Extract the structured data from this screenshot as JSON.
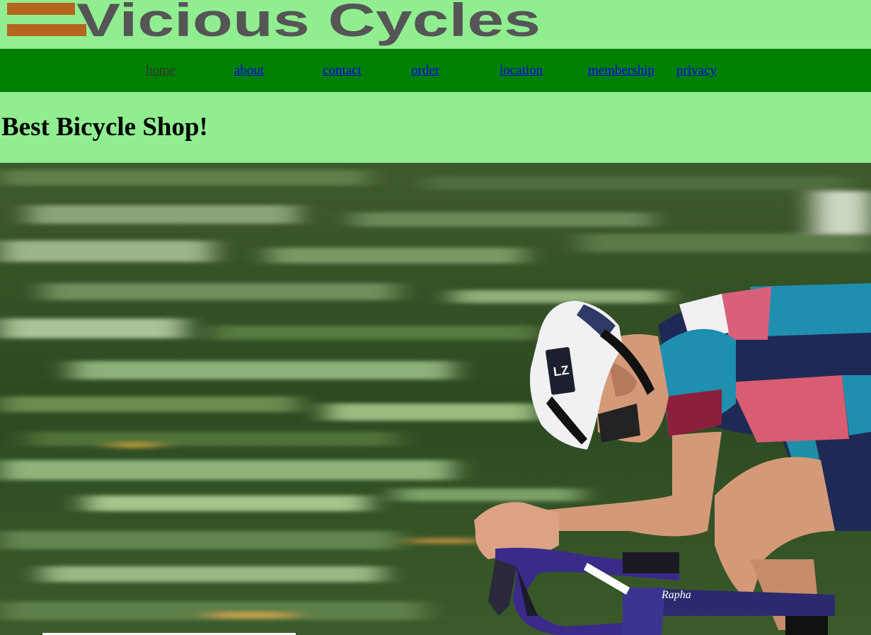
{
  "site": {
    "logo_text": "Vicious Cycles",
    "brand_colors": {
      "stripe": "#b5651d",
      "text": "#555555",
      "header_bg": "#90ee90",
      "nav_bg": "#008000"
    }
  },
  "nav": {
    "items": [
      {
        "label": "home",
        "current": true
      },
      {
        "label": "about"
      },
      {
        "label": "contact"
      },
      {
        "label": "order"
      },
      {
        "label": "location"
      },
      {
        "label": "membership"
      },
      {
        "label": "privacy"
      }
    ]
  },
  "main": {
    "heading": "Best Bicycle Shop!"
  },
  "hero": {
    "alt": "cyclist riding a road bike with motion-blurred green background",
    "helmet_badge": "LZ",
    "bike_brand": "Rapha"
  }
}
